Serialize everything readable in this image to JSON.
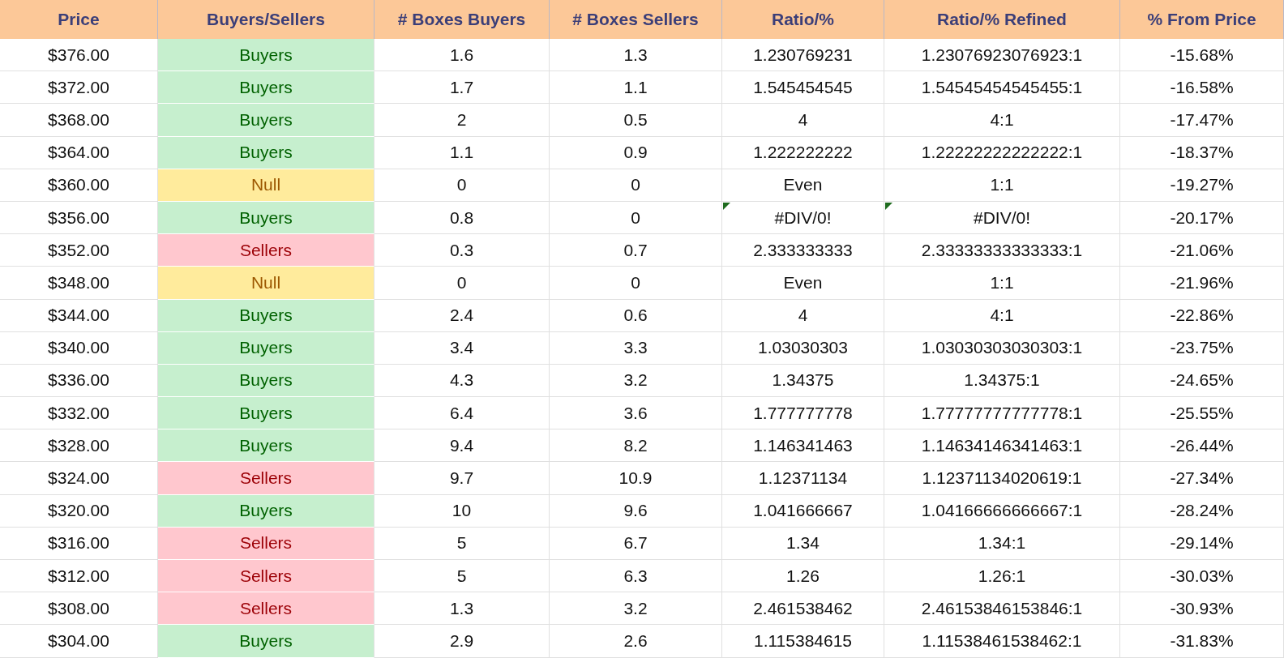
{
  "columns": [
    "Price",
    "Buyers/Sellers",
    "# Boxes Buyers",
    "# Boxes Sellers",
    "Ratio/%",
    "Ratio/% Refined",
    "% From Price"
  ],
  "rows": [
    {
      "price": "$376.00",
      "side": "Buyers",
      "kind": "buyers",
      "boxes_buyers": "1.6",
      "boxes_sellers": "1.3",
      "ratio": "1.230769231",
      "refined": "1.23076923076923:1",
      "from_price": "-15.68%",
      "flagged": false
    },
    {
      "price": "$372.00",
      "side": "Buyers",
      "kind": "buyers",
      "boxes_buyers": "1.7",
      "boxes_sellers": "1.1",
      "ratio": "1.545454545",
      "refined": "1.54545454545455:1",
      "from_price": "-16.58%",
      "flagged": false
    },
    {
      "price": "$368.00",
      "side": "Buyers",
      "kind": "buyers",
      "boxes_buyers": "2",
      "boxes_sellers": "0.5",
      "ratio": "4",
      "refined": "4:1",
      "from_price": "-17.47%",
      "flagged": false
    },
    {
      "price": "$364.00",
      "side": "Buyers",
      "kind": "buyers",
      "boxes_buyers": "1.1",
      "boxes_sellers": "0.9",
      "ratio": "1.222222222",
      "refined": "1.22222222222222:1",
      "from_price": "-18.37%",
      "flagged": false
    },
    {
      "price": "$360.00",
      "side": "Null",
      "kind": "null",
      "boxes_buyers": "0",
      "boxes_sellers": "0",
      "ratio": "Even",
      "refined": "1:1",
      "from_price": "-19.27%",
      "flagged": false
    },
    {
      "price": "$356.00",
      "side": "Buyers",
      "kind": "buyers",
      "boxes_buyers": "0.8",
      "boxes_sellers": "0",
      "ratio": "#DIV/0!",
      "refined": "#DIV/0!",
      "from_price": "-20.17%",
      "flagged": true
    },
    {
      "price": "$352.00",
      "side": "Sellers",
      "kind": "sellers",
      "boxes_buyers": "0.3",
      "boxes_sellers": "0.7",
      "ratio": "2.333333333",
      "refined": "2.33333333333333:1",
      "from_price": "-21.06%",
      "flagged": false
    },
    {
      "price": "$348.00",
      "side": "Null",
      "kind": "null",
      "boxes_buyers": "0",
      "boxes_sellers": "0",
      "ratio": "Even",
      "refined": "1:1",
      "from_price": "-21.96%",
      "flagged": false
    },
    {
      "price": "$344.00",
      "side": "Buyers",
      "kind": "buyers",
      "boxes_buyers": "2.4",
      "boxes_sellers": "0.6",
      "ratio": "4",
      "refined": "4:1",
      "from_price": "-22.86%",
      "flagged": false
    },
    {
      "price": "$340.00",
      "side": "Buyers",
      "kind": "buyers",
      "boxes_buyers": "3.4",
      "boxes_sellers": "3.3",
      "ratio": "1.03030303",
      "refined": "1.03030303030303:1",
      "from_price": "-23.75%",
      "flagged": false
    },
    {
      "price": "$336.00",
      "side": "Buyers",
      "kind": "buyers",
      "boxes_buyers": "4.3",
      "boxes_sellers": "3.2",
      "ratio": "1.34375",
      "refined": "1.34375:1",
      "from_price": "-24.65%",
      "flagged": false
    },
    {
      "price": "$332.00",
      "side": "Buyers",
      "kind": "buyers",
      "boxes_buyers": "6.4",
      "boxes_sellers": "3.6",
      "ratio": "1.777777778",
      "refined": "1.77777777777778:1",
      "from_price": "-25.55%",
      "flagged": false
    },
    {
      "price": "$328.00",
      "side": "Buyers",
      "kind": "buyers",
      "boxes_buyers": "9.4",
      "boxes_sellers": "8.2",
      "ratio": "1.146341463",
      "refined": "1.14634146341463:1",
      "from_price": "-26.44%",
      "flagged": false
    },
    {
      "price": "$324.00",
      "side": "Sellers",
      "kind": "sellers",
      "boxes_buyers": "9.7",
      "boxes_sellers": "10.9",
      "ratio": "1.12371134",
      "refined": "1.12371134020619:1",
      "from_price": "-27.34%",
      "flagged": false
    },
    {
      "price": "$320.00",
      "side": "Buyers",
      "kind": "buyers",
      "boxes_buyers": "10",
      "boxes_sellers": "9.6",
      "ratio": "1.041666667",
      "refined": "1.04166666666667:1",
      "from_price": "-28.24%",
      "flagged": false
    },
    {
      "price": "$316.00",
      "side": "Sellers",
      "kind": "sellers",
      "boxes_buyers": "5",
      "boxes_sellers": "6.7",
      "ratio": "1.34",
      "refined": "1.34:1",
      "from_price": "-29.14%",
      "flagged": false
    },
    {
      "price": "$312.00",
      "side": "Sellers",
      "kind": "sellers",
      "boxes_buyers": "5",
      "boxes_sellers": "6.3",
      "ratio": "1.26",
      "refined": "1.26:1",
      "from_price": "-30.03%",
      "flagged": false
    },
    {
      "price": "$308.00",
      "side": "Sellers",
      "kind": "sellers",
      "boxes_buyers": "1.3",
      "boxes_sellers": "3.2",
      "ratio": "2.461538462",
      "refined": "2.46153846153846:1",
      "from_price": "-30.93%",
      "flagged": false
    },
    {
      "price": "$304.00",
      "side": "Buyers",
      "kind": "buyers",
      "boxes_buyers": "2.9",
      "boxes_sellers": "2.6",
      "ratio": "1.115384615",
      "refined": "1.11538461538462:1",
      "from_price": "-31.83%",
      "flagged": false
    }
  ]
}
